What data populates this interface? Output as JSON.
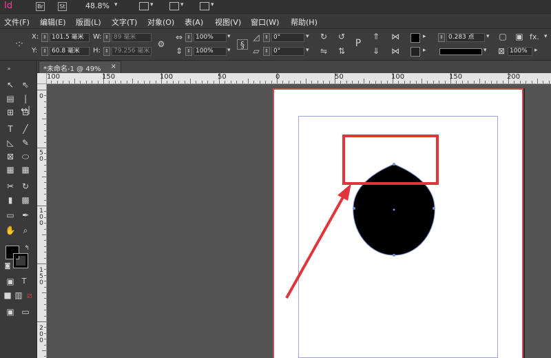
{
  "app": {
    "logo": "Id",
    "bridge_label": "Br",
    "stock_label": "St",
    "zoom": "48.8%"
  },
  "menu": [
    {
      "label": "文件(F)"
    },
    {
      "label": "编辑(E)"
    },
    {
      "label": "版面(L)"
    },
    {
      "label": "文字(T)"
    },
    {
      "label": "对象(O)"
    },
    {
      "label": "表(A)"
    },
    {
      "label": "视图(V)"
    },
    {
      "label": "窗口(W)"
    },
    {
      "label": "帮助(H)"
    }
  ],
  "control_panel": {
    "x_label": "X:",
    "x_value": "101.5 毫米",
    "y_label": "Y:",
    "y_value": "60.8 毫米",
    "w_label": "W:",
    "w_value": "89 毫米",
    "h_label": "H:",
    "h_value": "79.256 毫米",
    "scale_x": "100%",
    "scale_y": "100%",
    "rotate": "0°",
    "shear": "0°",
    "stroke_weight": "0.283 点",
    "opacity": "100%",
    "fx_label": "fx."
  },
  "document": {
    "tab_label": "*未命名-1 @ 49%",
    "close_glyph": "×"
  },
  "ruler": {
    "h_labels": [
      "100",
      "150",
      "100",
      "50",
      "0",
      "50",
      "100",
      "150",
      "200"
    ],
    "v_labels": [
      "0",
      "5\n0",
      "1\n0\n0",
      "1\n5\n0",
      "2\n0\n0"
    ]
  },
  "colors": {
    "annotation_red": "#e0353b",
    "page_border": "#c0504d",
    "margin_guide": "#9fa0d8",
    "shape_fill": "#000000"
  }
}
